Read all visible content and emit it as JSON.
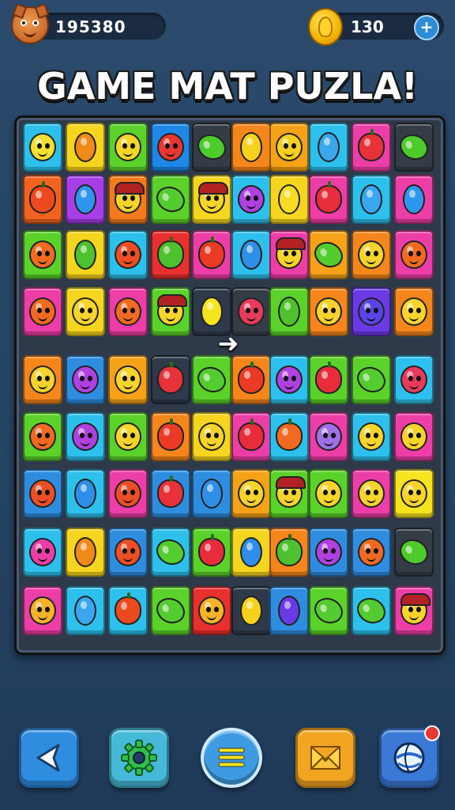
{
  "header": {
    "score": "195380",
    "coins": "130",
    "plus_label": "+"
  },
  "title": "GAME MAT PUZLA!",
  "board": {
    "rows": [
      [
        {
          "bg": "#2ec0ec",
          "p": "face",
          "c": "#f4e030"
        },
        {
          "bg": "#f6d51e",
          "p": "oval",
          "c": "#f08a18"
        },
        {
          "bg": "#5bd22a",
          "p": "face",
          "c": "#f6d428"
        },
        {
          "bg": "#1f88e6",
          "p": "face",
          "c": "#e8382e"
        },
        {
          "bg": "#343c46",
          "p": "leaf",
          "c": "#4ecb2c"
        },
        {
          "bg": "#f4861c",
          "p": "oval",
          "c": "#f6d21c"
        },
        {
          "bg": "#f6a218",
          "p": "face",
          "c": "#f6d020"
        },
        {
          "bg": "#2ec0ec",
          "p": "oval",
          "c": "#3aa6ee"
        },
        {
          "bg": "#ec3ea6",
          "p": "apple",
          "c": "#e8323a"
        },
        {
          "bg": "#343c46",
          "p": "leaf",
          "c": "#4ecb2c"
        }
      ],
      [
        {
          "bg": "#f1631e",
          "p": "apple",
          "c": "#ec4a1e"
        },
        {
          "bg": "#a73ee8",
          "p": "oval",
          "c": "#2f96ee"
        },
        {
          "bg": "#f47a1c",
          "p": "face",
          "c": "#f6d42c",
          "hair": true
        },
        {
          "bg": "#5bd22a",
          "p": "leaf",
          "c": "#52cc2e"
        },
        {
          "bg": "#f6d51e",
          "p": "face",
          "c": "#f6d42c",
          "hair": true
        },
        {
          "bg": "#2ec0ec",
          "p": "face",
          "c": "#b040e0"
        },
        {
          "bg": "#f6d51e",
          "p": "oval",
          "c": "#f6dc22"
        },
        {
          "bg": "#ec3ea6",
          "p": "apple",
          "c": "#e82c3c"
        },
        {
          "bg": "#2ec0ec",
          "p": "oval",
          "c": "#3aa6ee"
        },
        {
          "bg": "#ec3ea6",
          "p": "oval",
          "c": "#2f96ee"
        }
      ],
      [
        {
          "bg": "#5bd22a",
          "p": "face",
          "c": "#f06a22"
        },
        {
          "bg": "#f6d51e",
          "p": "oval",
          "c": "#4ec22e"
        },
        {
          "bg": "#2ec0ec",
          "p": "face",
          "c": "#ee4e26"
        },
        {
          "bg": "#e8302e",
          "p": "apple",
          "c": "#4ec22e"
        },
        {
          "bg": "#ec3ea6",
          "p": "apple",
          "c": "#ec3a24"
        },
        {
          "bg": "#2ec0ec",
          "p": "oval",
          "c": "#2f8ee8"
        },
        {
          "bg": "#ec3ea6",
          "p": "face",
          "c": "#f6d42c",
          "hair": true
        },
        {
          "bg": "#f6a218",
          "p": "leaf",
          "c": "#52cc2e"
        },
        {
          "bg": "#f4861c",
          "p": "face",
          "c": "#f6d42c"
        },
        {
          "bg": "#ec3ea6",
          "p": "face",
          "c": "#f06a22"
        }
      ],
      [
        {
          "bg": "#ec3ea6",
          "p": "face",
          "c": "#f06a22"
        },
        {
          "bg": "#f6d51e",
          "p": "face",
          "c": "#f6d42c"
        },
        {
          "bg": "#ec3ea6",
          "p": "face",
          "c": "#f06a22"
        },
        {
          "bg": "#5bd22a",
          "p": "face",
          "c": "#f6d42c",
          "hair": true
        },
        {
          "bg": "#2e3a4a",
          "p": "oval",
          "c": "#f6e41e"
        },
        {
          "bg": "#343c46",
          "p": "face",
          "c": "#e83a5a"
        },
        {
          "bg": "#5bd22a",
          "p": "oval",
          "c": "#4ec22e"
        },
        {
          "bg": "#f4861c",
          "p": "face",
          "c": "#f6d42c"
        },
        {
          "bg": "#6a3ae6",
          "p": "face",
          "c": "#5a44e6"
        },
        {
          "bg": "#f4861c",
          "p": "face",
          "c": "#f6d42c"
        }
      ],
      [
        {
          "bg": "#f4861c",
          "p": "face",
          "c": "#f6d42c"
        },
        {
          "bg": "#2f8de0",
          "p": "face",
          "c": "#b040e0"
        },
        {
          "bg": "#f6a218",
          "p": "face",
          "c": "#f6d42c"
        },
        {
          "bg": "#2e3a4a",
          "p": "apple",
          "c": "#e8323a"
        },
        {
          "bg": "#5bd22a",
          "p": "leaf",
          "c": "#52cc2e"
        },
        {
          "bg": "#f4861c",
          "p": "apple",
          "c": "#ec3a24"
        },
        {
          "bg": "#2ec0ec",
          "p": "face",
          "c": "#b040e0"
        },
        {
          "bg": "#5bd22a",
          "p": "apple",
          "c": "#e82c3c"
        },
        {
          "bg": "#5bd22a",
          "p": "leaf",
          "c": "#52cc2e"
        },
        {
          "bg": "#2ec0ec",
          "p": "face",
          "c": "#e83a5a"
        }
      ],
      [
        {
          "bg": "#5bd22a",
          "p": "face",
          "c": "#f06a22"
        },
        {
          "bg": "#2ec0ec",
          "p": "face",
          "c": "#b040e0"
        },
        {
          "bg": "#5bd22a",
          "p": "face",
          "c": "#f6d42c"
        },
        {
          "bg": "#f4861c",
          "p": "apple",
          "c": "#ec3a24"
        },
        {
          "bg": "#f6d51e",
          "p": "face",
          "c": "#f6d42c"
        },
        {
          "bg": "#ec3ea6",
          "p": "apple",
          "c": "#e82c3c"
        },
        {
          "bg": "#2ec0ec",
          "p": "apple",
          "c": "#f06a22"
        },
        {
          "bg": "#ec3ea6",
          "p": "face",
          "c": "#a070e6"
        },
        {
          "bg": "#2ec0ec",
          "p": "face",
          "c": "#f6d42c"
        },
        {
          "bg": "#ec3ea6",
          "p": "face",
          "c": "#f6d42c"
        }
      ],
      [
        {
          "bg": "#2f8de0",
          "p": "face",
          "c": "#ee4e26"
        },
        {
          "bg": "#2ec0ec",
          "p": "oval",
          "c": "#2f8ee8"
        },
        {
          "bg": "#ec3ea6",
          "p": "face",
          "c": "#ee4e26"
        },
        {
          "bg": "#2f8de0",
          "p": "apple",
          "c": "#e8323a"
        },
        {
          "bg": "#2f8de0",
          "p": "oval",
          "c": "#2f8ee8"
        },
        {
          "bg": "#f6a218",
          "p": "face",
          "c": "#f6d42c"
        },
        {
          "bg": "#5bd22a",
          "p": "face",
          "c": "#f6d42c",
          "hair": true
        },
        {
          "bg": "#5bd22a",
          "p": "face",
          "c": "#f6d42c"
        },
        {
          "bg": "#ec3ea6",
          "p": "face",
          "c": "#f6d42c"
        },
        {
          "bg": "#f6e41e",
          "p": "face",
          "c": "#f6d42c"
        }
      ],
      [
        {
          "bg": "#2ec0ec",
          "p": "face",
          "c": "#ec3ea6"
        },
        {
          "bg": "#f6d51e",
          "p": "oval",
          "c": "#f08a18"
        },
        {
          "bg": "#2f8de0",
          "p": "face",
          "c": "#ee4e26"
        },
        {
          "bg": "#2ec0ec",
          "p": "leaf",
          "c": "#52cc2e"
        },
        {
          "bg": "#5bd22a",
          "p": "apple",
          "c": "#e82c3c"
        },
        {
          "bg": "#f6d51e",
          "p": "oval",
          "c": "#2f8ee8"
        },
        {
          "bg": "#f4861c",
          "p": "apple",
          "c": "#4ec22e"
        },
        {
          "bg": "#2f8de0",
          "p": "face",
          "c": "#b040e0"
        },
        {
          "bg": "#2f8de0",
          "p": "face",
          "c": "#f06a22"
        },
        {
          "bg": "#343c46",
          "p": "leaf",
          "c": "#4ecb2c"
        }
      ],
      [
        {
          "bg": "#ec3ea6",
          "p": "face",
          "c": "#f6b228"
        },
        {
          "bg": "#2ec0ec",
          "p": "oval",
          "c": "#3aa6ee"
        },
        {
          "bg": "#2ec0ec",
          "p": "apple",
          "c": "#ec4a1e"
        },
        {
          "bg": "#5bd22a",
          "p": "leaf",
          "c": "#52cc2e"
        },
        {
          "bg": "#e8302e",
          "p": "face",
          "c": "#f6b228"
        },
        {
          "bg": "#2e3a4a",
          "p": "oval",
          "c": "#f6d21c"
        },
        {
          "bg": "#2f8de0",
          "p": "oval",
          "c": "#6a3ae6"
        },
        {
          "bg": "#5bd22a",
          "p": "leaf",
          "c": "#52cc2e"
        },
        {
          "bg": "#2ec0ec",
          "p": "leaf",
          "c": "#52cc2e"
        },
        {
          "bg": "#ec3ea6",
          "p": "face",
          "c": "#f6d42c",
          "hair": true
        }
      ]
    ]
  },
  "icons": {
    "avatar": "fox-avatar-icon",
    "coin": "gold-coin-icon",
    "pointer": "pointer-hand-icon",
    "share": "share-icon",
    "settings": "gear-icon",
    "menu": "menu-icon",
    "mail": "mail-icon",
    "globe": "globe-icon"
  }
}
